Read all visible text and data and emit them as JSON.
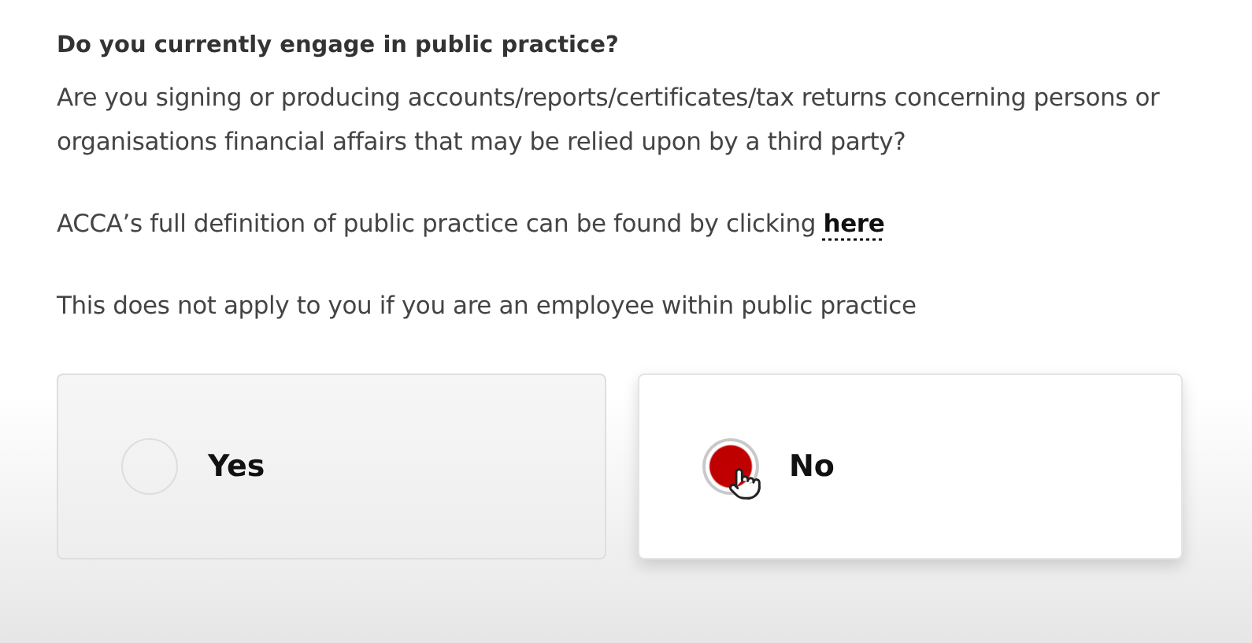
{
  "question": {
    "title": "Do you currently engage in public practice?",
    "description": "Are you signing or producing accounts/reports/certificates/tax returns concerning persons or organisations financial affairs that may be relied upon by a third party?",
    "definition": {
      "text": "ACCA’s full definition of public practice can be found by clicking",
      "link": "here"
    },
    "note": "This does not apply to you if you are an employee within public practice"
  },
  "options": [
    {
      "label": "Yes",
      "selected": false,
      "hovered": false
    },
    {
      "label": "No",
      "selected": true,
      "hovered": true
    }
  ]
}
